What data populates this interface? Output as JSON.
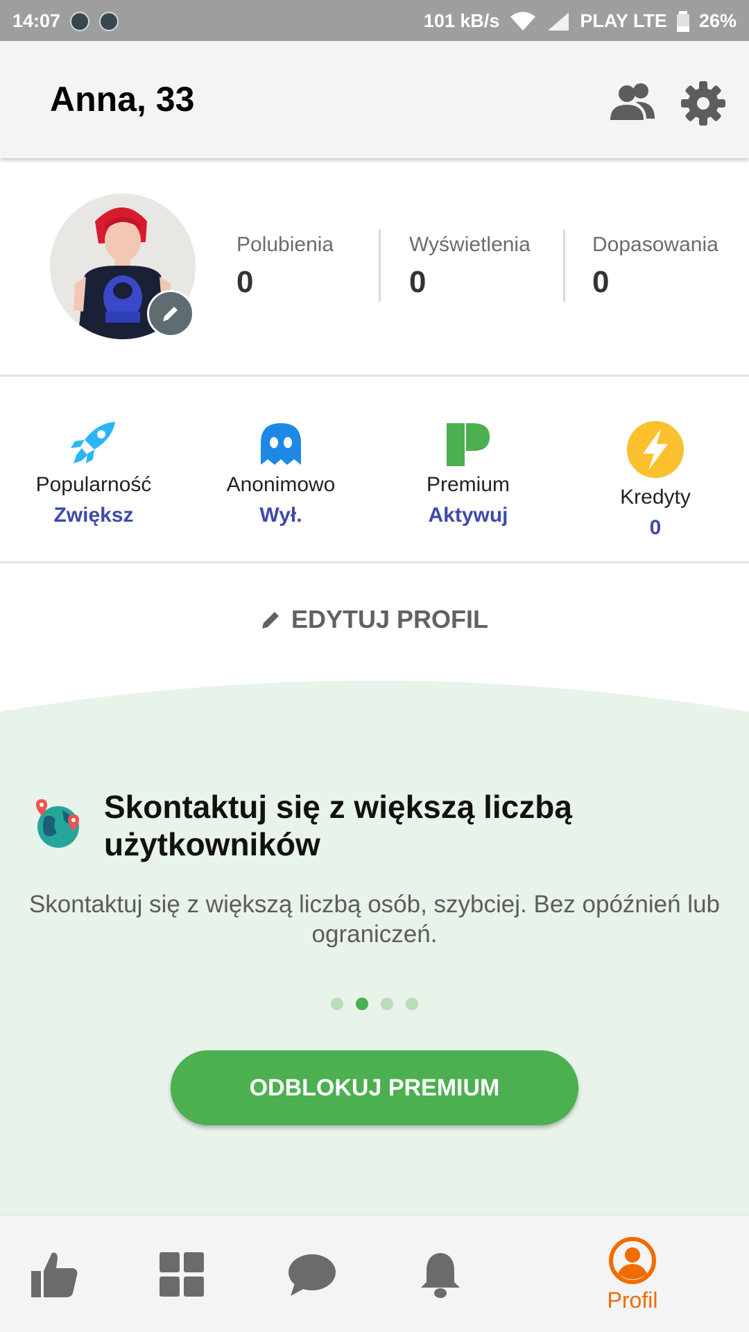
{
  "status_bar": {
    "time": "14:07",
    "speed": "101 kB/s",
    "carrier": "PLAY LTE",
    "battery": "26%"
  },
  "header": {
    "title": "Anna, 33"
  },
  "stats": [
    {
      "label": "Polubienia",
      "value": "0"
    },
    {
      "label": "Wyświetlenia",
      "value": "0"
    },
    {
      "label": "Dopasowania",
      "value": "0"
    }
  ],
  "features": [
    {
      "label": "Popularność",
      "action": "Zwiększ",
      "icon": "rocket-icon"
    },
    {
      "label": "Anonimowo",
      "action": "Wył.",
      "icon": "ghost-icon"
    },
    {
      "label": "Premium",
      "action": "Aktywuj",
      "icon": "premium-p-icon"
    },
    {
      "label": "Kredyty",
      "action": "0",
      "icon": "lightning-icon"
    }
  ],
  "edit_profile": {
    "label": "EDYTUJ PROFIL"
  },
  "promo": {
    "title": "Skontaktuj się z większą liczbą użytkowników",
    "text": "Skontaktuj się z większą liczbą osób, szybciej. Bez opóźnień lub ograniczeń.",
    "button": "ODBLOKUJ PREMIUM",
    "slides": 4,
    "active_slide": 2
  },
  "bottom_nav": {
    "active": "profile",
    "profile_label": "Profil"
  },
  "colors": {
    "accent_green": "#4caf50",
    "link_blue": "#3f4aa8",
    "nav_active": "#ef6c00",
    "promo_bg": "#e8f3e9"
  }
}
